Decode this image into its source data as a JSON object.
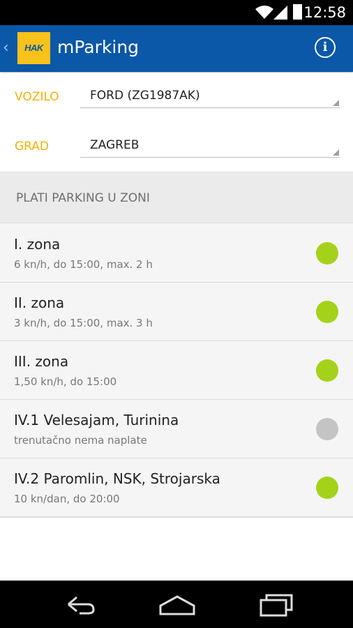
{
  "status_bar": {
    "time": "12:58"
  },
  "app_bar": {
    "logo_text": "HAK",
    "title": "mParking"
  },
  "form": {
    "vehicle_label": "VOZILO",
    "vehicle_value": "FORD (ZG1987AK)",
    "city_label": "GRAD",
    "city_value": "ZAGREB"
  },
  "section": {
    "title": "PLATI PARKING U ZONI"
  },
  "zones": [
    {
      "name": "I. zona",
      "detail": "6 kn/h, do 15:00, max. 2 h",
      "active": true
    },
    {
      "name": "II. zona",
      "detail": "3 kn/h, do 15:00, max. 3 h",
      "active": true
    },
    {
      "name": "III. zona",
      "detail": "1,50 kn/h, do 15:00",
      "active": true
    },
    {
      "name": "IV.1 Velesajam, Turinina",
      "detail": "trenutačno nema naplate",
      "active": false
    },
    {
      "name": "IV.2 Paromlin, NSK, Strojarska",
      "detail": "10 kn/dan, do 20:00",
      "active": true
    }
  ],
  "colors": {
    "app_bar": "#0b57a8",
    "label_accent": "#f2b100",
    "zone_active": "#a4d21a",
    "zone_inactive": "#c4c4c4"
  },
  "icons": {
    "back": "chevron-left-icon",
    "info": "info-circle-icon",
    "nav_back": "back-arrow-icon",
    "nav_home": "home-icon",
    "nav_recents": "recent-apps-icon"
  }
}
